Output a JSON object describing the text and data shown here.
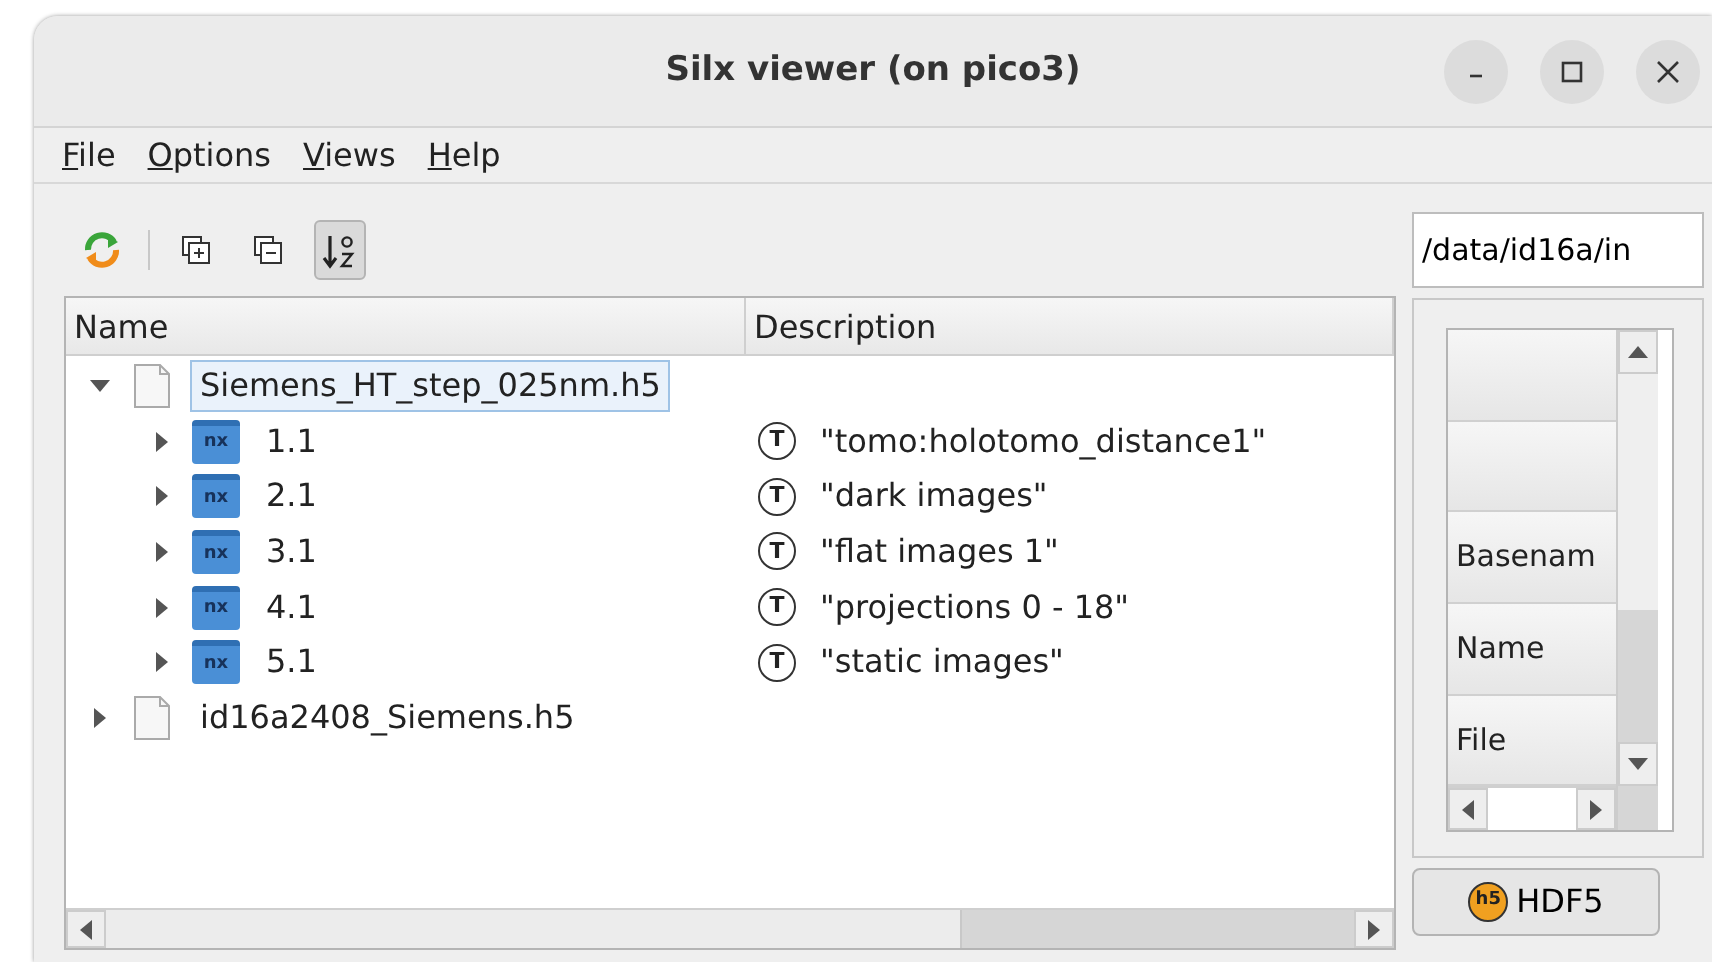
{
  "window": {
    "title": "Silx viewer (on pico3)"
  },
  "menu": [
    {
      "mnemonic": "F",
      "rest": "ile"
    },
    {
      "mnemonic": "O",
      "rest": "ptions"
    },
    {
      "mnemonic": "V",
      "rest": "iews"
    },
    {
      "mnemonic": "H",
      "rest": "elp"
    }
  ],
  "toolbar": [
    {
      "kind": "refresh"
    },
    {
      "kind": "separator"
    },
    {
      "kind": "expand"
    },
    {
      "kind": "collapse"
    },
    {
      "kind": "sort",
      "pressed": true
    }
  ],
  "tree": {
    "columns": [
      "Name",
      "Description"
    ],
    "rows": [
      {
        "name": "Siemens_HT_step_025nm.h5",
        "kind": "file",
        "expanded": true,
        "selected": true,
        "children": [
          {
            "name": "1.1",
            "kind": "nxgroup",
            "icon_label": "nx",
            "type_icon": "T",
            "description": "\"tomo:holotomo_distance1\"",
            "expanded": false,
            "selected": false
          },
          {
            "name": "2.1",
            "kind": "nxgroup",
            "icon_label": "nx",
            "type_icon": "T",
            "description": "\"dark images\"",
            "expanded": false,
            "selected": false
          },
          {
            "name": "3.1",
            "kind": "nxgroup",
            "icon_label": "nx",
            "type_icon": "T",
            "description": "\"flat images 1\"",
            "expanded": false,
            "selected": false
          },
          {
            "name": "4.1",
            "kind": "nxgroup",
            "icon_label": "nx",
            "type_icon": "T",
            "description": "\"projections 0 - 18\"",
            "expanded": false,
            "selected": false
          },
          {
            "name": "5.1",
            "kind": "nxgroup",
            "icon_label": "nx",
            "type_icon": "T",
            "description": "\"static images\"",
            "expanded": false,
            "selected": false
          }
        ]
      },
      {
        "name": "id16a2408_Siemens.h5",
        "kind": "file",
        "expanded": false,
        "selected": false
      }
    ]
  },
  "path_field": {
    "value": "/data/id16a/in"
  },
  "info_table": {
    "row_headers": [
      {
        "kind": "blank"
      },
      {
        "kind": "blank"
      },
      {
        "kind": "text",
        "label": "Basenam"
      },
      {
        "kind": "text",
        "label": "Name"
      },
      {
        "kind": "text",
        "label": "File"
      }
    ]
  },
  "format_button": {
    "label": "HDF5",
    "icon_label": "h5"
  }
}
